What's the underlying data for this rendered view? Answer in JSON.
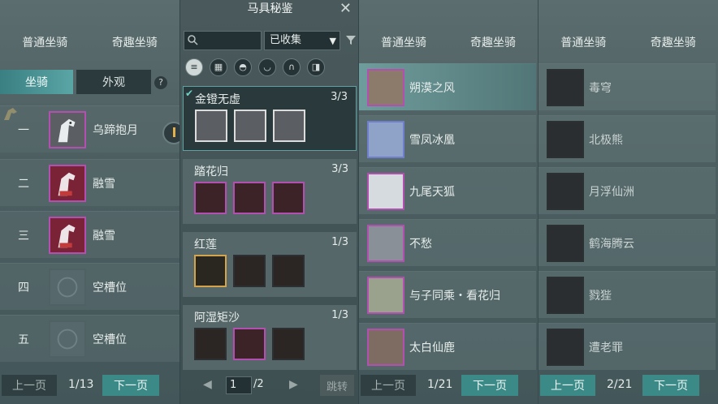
{
  "panel1": {
    "tabs": [
      "普通坐骑",
      "奇趣坐骑"
    ],
    "seg_active": "坐骑",
    "seg_inactive": "外观",
    "help": "?",
    "rows": [
      {
        "num": "一",
        "name": "乌蹄抱月",
        "thumb": "white-horse"
      },
      {
        "num": "二",
        "name": "融雪",
        "thumb": "red-horse"
      },
      {
        "num": "三",
        "name": "融雪",
        "thumb": "red-horse"
      },
      {
        "num": "四",
        "name": "空槽位",
        "thumb": "empty"
      },
      {
        "num": "五",
        "name": "空槽位",
        "thumb": "empty"
      }
    ],
    "prev": "上一页",
    "page": "1/13",
    "next": "下一页"
  },
  "panel2": {
    "title": "马具秘鉴",
    "close": "✕",
    "filter": "已收集",
    "categories": [
      "list-icon",
      "grid-icon",
      "saddle-icon",
      "armor-icon",
      "horseshoe-icon",
      "rein-icon"
    ],
    "sets": [
      {
        "name": "金镫无虚",
        "count": "3/3"
      },
      {
        "name": "踏花归",
        "count": "3/3"
      },
      {
        "name": "红莲",
        "count": "1/3"
      },
      {
        "name": "阿湿矩沙",
        "count": "1/3"
      }
    ],
    "page_input": "1",
    "page_total": "/2",
    "jump": "跳转"
  },
  "panel3": {
    "tabs": [
      "普通坐骑",
      "奇趣坐骑"
    ],
    "rows": [
      {
        "name": "朔漠之风"
      },
      {
        "name": "雪凤冰凰"
      },
      {
        "name": "九尾天狐"
      },
      {
        "name": "不愁"
      },
      {
        "name": "与子同乘・看花归"
      },
      {
        "name": "太白仙鹿"
      }
    ],
    "prev": "上一页",
    "page": "1/21",
    "next": "下一页"
  },
  "panel4": {
    "tabs": [
      "普通坐骑",
      "奇趣坐骑"
    ],
    "rows": [
      {
        "name": "毒穹"
      },
      {
        "name": "北极熊"
      },
      {
        "name": "月浮仙洲"
      },
      {
        "name": "鹤海腾云"
      },
      {
        "name": "戮狴"
      },
      {
        "name": "遭老罪"
      }
    ],
    "prev": "上一页",
    "page": "2/21",
    "next": "下一页"
  },
  "colors": {
    "accent": "#3c8a87",
    "rarity_purple": "#b44fb2",
    "rarity_gold": "#d4a44c",
    "rarity_blue": "#6f7fce"
  }
}
